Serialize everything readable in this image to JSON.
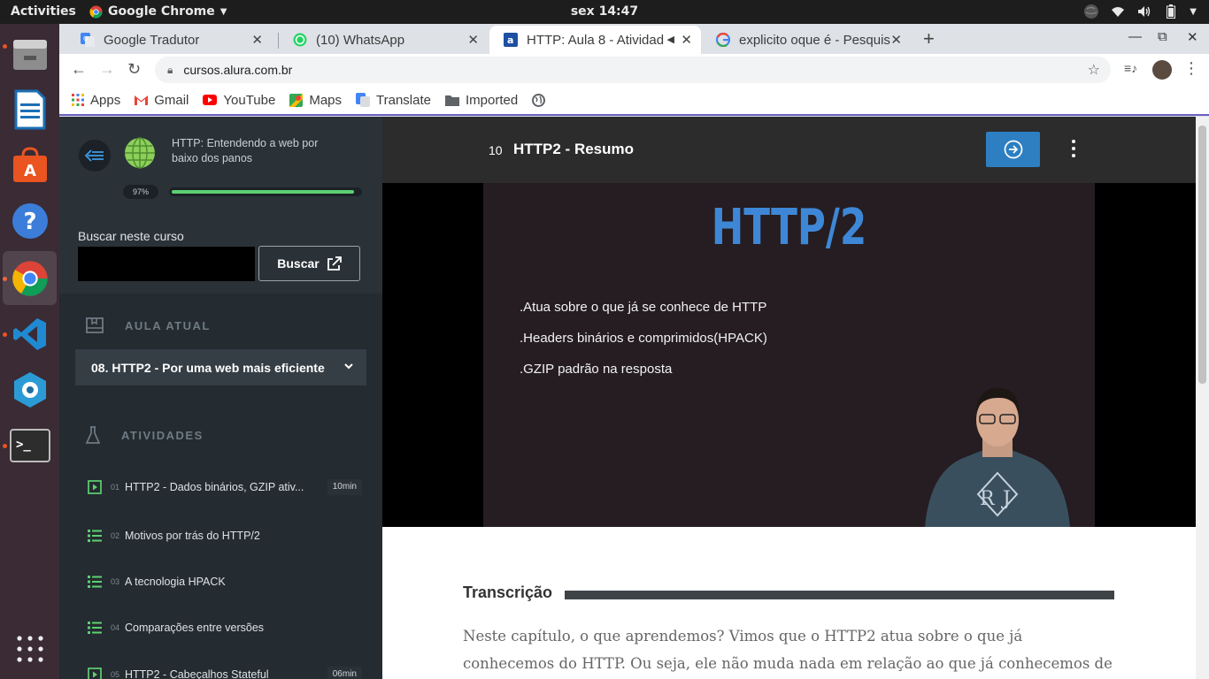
{
  "system": {
    "activities": "Activities",
    "app_name": "Google Chrome",
    "clock": "sex 14:47"
  },
  "dock": {
    "items": [
      "files-icon",
      "writer-icon",
      "software-center-icon",
      "help-icon",
      "chrome-icon",
      "vscode-icon",
      "vpn-icon",
      "terminal-icon",
      "app-grid-icon"
    ]
  },
  "browser": {
    "tabs": [
      {
        "title": "Google Tradutor",
        "icon": "translate-icon"
      },
      {
        "title": "(10) WhatsApp",
        "icon": "whatsapp-icon"
      },
      {
        "title": "HTTP: Aula 8 - Atividad",
        "icon": "alura-icon"
      },
      {
        "title": "explicito oque é - Pesquis",
        "icon": "google-icon"
      }
    ],
    "url": "cursos.alura.com.br",
    "bookmarks": [
      {
        "label": "Apps"
      },
      {
        "label": "Gmail"
      },
      {
        "label": "YouTube"
      },
      {
        "label": "Maps"
      },
      {
        "label": "Translate"
      },
      {
        "label": "Imported"
      }
    ]
  },
  "sidebar": {
    "course_title": "HTTP: Entendendo a web por baixo dos panos",
    "progress_label": "97%",
    "progress": 0.97,
    "search_label": "Buscar neste curso",
    "search_value": "",
    "search_button": "Buscar",
    "current_section_label": "AULA ATUAL",
    "current_lesson": "08. HTTP2 - Por uma web mais eficiente",
    "activities_label": "ATIVIDADES",
    "activities": [
      {
        "num": "01",
        "title": "HTTP2 - Dados binários, GZIP ativ...",
        "duration": "10min",
        "type": "video"
      },
      {
        "num": "02",
        "title": "Motivos por trás do HTTP/2",
        "duration": "",
        "type": "list"
      },
      {
        "num": "03",
        "title": "A tecnologia HPACK",
        "duration": "",
        "type": "list"
      },
      {
        "num": "04",
        "title": "Comparações entre versões",
        "duration": "",
        "type": "list"
      },
      {
        "num": "05",
        "title": "HTTP2 - Cabeçalhos Stateful",
        "duration": "06min",
        "type": "video"
      }
    ]
  },
  "content": {
    "lesson_number": "10",
    "lesson_title": "HTTP2 - Resumo",
    "slide": {
      "title": "HTTP/2",
      "bullets": [
        ".Atua sobre o que já se conhece de HTTP",
        ".Headers binários e comprimidos(HPACK)",
        ".GZIP padrão na resposta"
      ]
    },
    "transcript_heading": "Transcrição",
    "transcript_text": "Neste capítulo, o que aprendemos? Vimos que o HTTP2 atua sobre o que já conhecemos do HTTP. Ou seja, ele não muda nada em relação ao que já conhecemos de HTTP. E que todo o"
  },
  "colors": {
    "sidebar_bg": "#242b31",
    "accent_blue": "#2d7fc1",
    "progress_green": "#5ed070",
    "slide_title": "#3e87d6"
  }
}
